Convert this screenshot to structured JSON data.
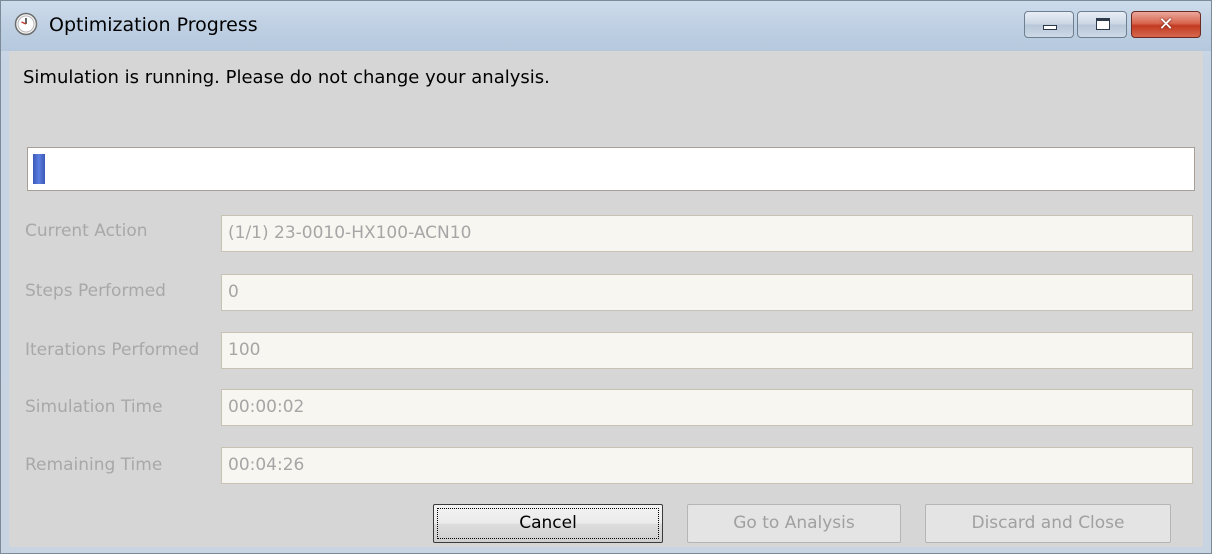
{
  "window": {
    "title": "Optimization Progress",
    "icon": "clock-icon",
    "controls": {
      "minimize": "minimize-icon",
      "maximize": "maximize-icon",
      "close": "close-icon",
      "close_glyph": "✕"
    }
  },
  "message": "Simulation is running. Please do not change your analysis.",
  "progress": {
    "value_fraction": 0.01,
    "color": "#4a6bd0"
  },
  "fields": [
    {
      "label": "Current Action",
      "value": "(1/1) 23-0010-HX100-ACN10"
    },
    {
      "label": "Steps Performed",
      "value": "0"
    },
    {
      "label": "Iterations Performed",
      "value": "100"
    },
    {
      "label": "Simulation Time",
      "value": "00:00:02"
    },
    {
      "label": "Remaining Time",
      "value": "00:04:26"
    }
  ],
  "buttons": {
    "cancel": "Cancel",
    "go_to_analysis": "Go to Analysis",
    "discard_and_close": "Discard and Close"
  }
}
